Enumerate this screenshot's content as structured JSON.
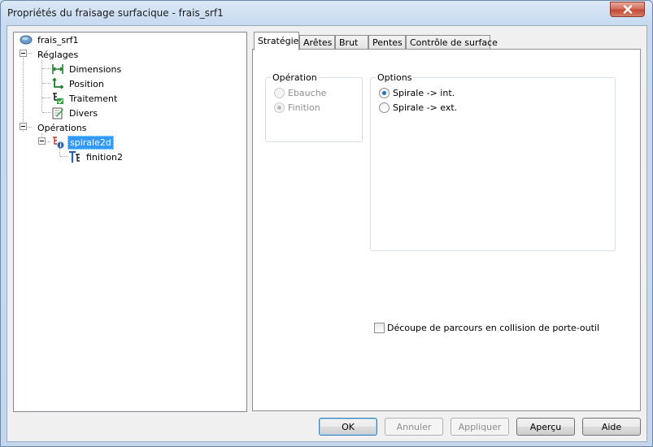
{
  "window": {
    "title": "Propriétés du fraisage surfacique - frais_srf1"
  },
  "tree": {
    "root": "frais_srf1",
    "settings_label": "Réglages",
    "settings_items": [
      "Dimensions",
      "Position",
      "Traitement",
      "Divers"
    ],
    "operations_label": "Opérations",
    "operation": "spirale2d",
    "sub_operation": "finition2",
    "selected": "spirale2d"
  },
  "tabs": [
    {
      "label": "Stratégie",
      "active": true
    },
    {
      "label": "Arêtes",
      "active": false
    },
    {
      "label": "Brut",
      "active": false
    },
    {
      "label": "Pentes",
      "active": false
    },
    {
      "label": "Contrôle de surface",
      "active": false
    }
  ],
  "strategy": {
    "operation_group": {
      "title": "Opération",
      "options": [
        {
          "label": "Ebauche",
          "checked": false,
          "enabled": false
        },
        {
          "label": "Finition",
          "checked": true,
          "enabled": false
        }
      ]
    },
    "options_group": {
      "title": "Options",
      "options": [
        {
          "label": "Spirale -> int.",
          "checked": true,
          "enabled": true
        },
        {
          "label": "Spirale -> ext.",
          "checked": false,
          "enabled": true
        }
      ]
    },
    "collision_checkbox": {
      "label": "Découpe de parcours en collision de porte-outil",
      "checked": false
    }
  },
  "buttons": {
    "ok": "OK",
    "cancel": "Annuler",
    "apply": "Appliquer",
    "preview": "Aperçu",
    "help": "Aide"
  },
  "colors": {
    "selection": "#3399ff",
    "close_button": "#c44a34",
    "icon_green": "#1e7f2a"
  }
}
